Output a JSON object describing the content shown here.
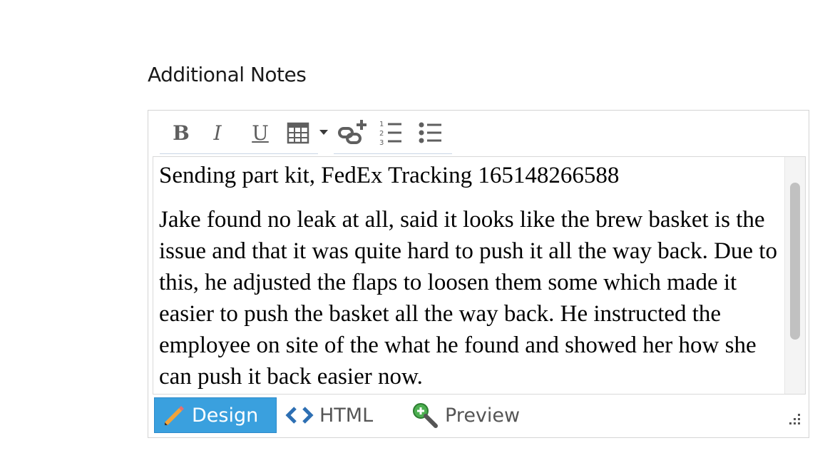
{
  "section": {
    "label": "Additional Notes"
  },
  "toolbar": {
    "bold": "B",
    "italic": "I",
    "underline": "U",
    "icons": [
      "bold",
      "italic",
      "underline",
      "table-icon",
      "dropdown-caret-icon",
      "insert-link-icon",
      "ordered-list-icon",
      "unordered-list-icon"
    ]
  },
  "content": {
    "paragraphs": [
      "Sending part kit, FedEx Tracking 165148266588",
      "Jake found no leak at all, said it looks like the brew basket is the issue and that it was quite hard to push it all the way back. Due to this, he adjusted the flaps to loosen them some which made it easier to push the basket all the way back. He instructed the employee on site of the what he found and showed her how she can push it back easier now."
    ]
  },
  "modes": {
    "design": "Design",
    "html": "HTML",
    "preview": "Preview",
    "active": "Design"
  },
  "colors": {
    "active_tab": "#3aa0de",
    "html_icon": "#2d6fb3",
    "text": "#000000"
  }
}
